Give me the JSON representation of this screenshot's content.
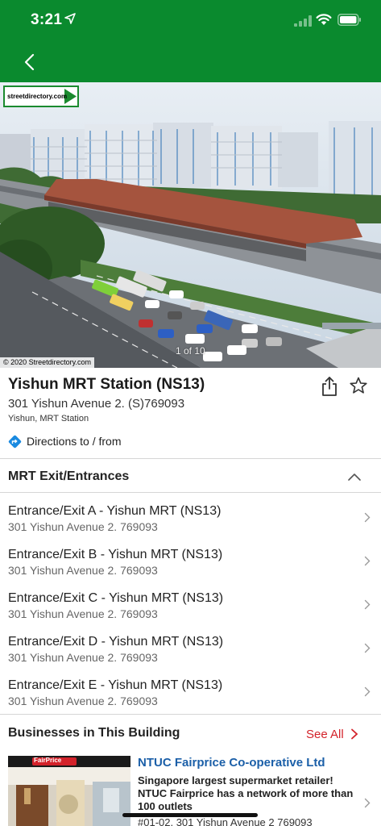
{
  "status_bar": {
    "time": "3:21"
  },
  "photo": {
    "logo_text": "streetdirectory.com",
    "credit": "© 2020 Streetdirectory.com",
    "counter": "1 of 10"
  },
  "place": {
    "title": "Yishun MRT Station (NS13)",
    "address": "301 Yishun Avenue 2. (S)769093",
    "subtitle": "Yishun, MRT Station",
    "directions_label": "Directions to / from"
  },
  "exits": {
    "heading": "MRT Exit/Entrances",
    "items": [
      {
        "name": "Entrance/Exit A - Yishun MRT (NS13)",
        "address": "301 Yishun Avenue 2. 769093"
      },
      {
        "name": "Entrance/Exit B - Yishun MRT (NS13)",
        "address": "301 Yishun Avenue 2. 769093"
      },
      {
        "name": "Entrance/Exit C - Yishun MRT (NS13)",
        "address": "301 Yishun Avenue 2. 769093"
      },
      {
        "name": "Entrance/Exit D - Yishun MRT (NS13)",
        "address": "301 Yishun Avenue 2. 769093"
      },
      {
        "name": "Entrance/Exit E - Yishun MRT (NS13)",
        "address": "301 Yishun Avenue 2. 769093"
      }
    ]
  },
  "businesses": {
    "heading": "Businesses in This Building",
    "see_all": "See All",
    "items": [
      {
        "name": "NTUC Fairprice Co-operative Ltd",
        "description": "Singapore largest supermarket retailer! NTUC Fairprice has a network of more than 100 outlets",
        "address": "#01-02, 301 Yishun Avenue 2 769093",
        "thumb_sign": "FairPrice"
      }
    ]
  },
  "colors": {
    "header_green": "#0a8a2e",
    "link_blue": "#1b5fa8",
    "accent_red": "#d3222a",
    "directions_blue": "#1a8ae0"
  },
  "icons": {
    "back": "chevron-left-icon",
    "share": "share-icon",
    "favorite": "star-outline-icon",
    "directions": "directions-diamond-icon",
    "collapse": "chevron-up-icon",
    "row_arrow": "chevron-right-icon"
  }
}
